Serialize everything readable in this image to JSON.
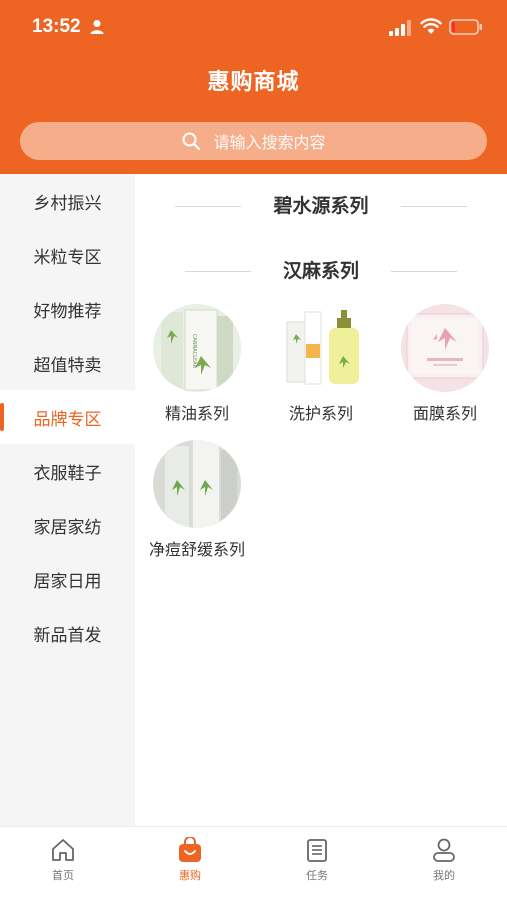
{
  "status_bar": {
    "time": "13:52"
  },
  "header": {
    "title": "惠购商城"
  },
  "search": {
    "placeholder": "请输入搜索内容"
  },
  "sidebar": {
    "items": [
      {
        "label": "乡村振兴",
        "active": false
      },
      {
        "label": "米粒专区",
        "active": false
      },
      {
        "label": "好物推荐",
        "active": false
      },
      {
        "label": "超值特卖",
        "active": false
      },
      {
        "label": "品牌专区",
        "active": true
      },
      {
        "label": "衣服鞋子",
        "active": false
      },
      {
        "label": "家居家纺",
        "active": false
      },
      {
        "label": "居家日用",
        "active": false
      },
      {
        "label": "新品首发",
        "active": false
      }
    ]
  },
  "content": {
    "sections": [
      {
        "title": "碧水源系列",
        "products": []
      },
      {
        "title": "汉麻系列",
        "products": [
          {
            "label": "精油系列"
          },
          {
            "label": "洗护系列"
          },
          {
            "label": "面膜系列"
          },
          {
            "label": "净痘舒缓系列"
          }
        ]
      }
    ]
  },
  "tabbar": {
    "items": [
      {
        "label": "首页",
        "icon": "home-icon",
        "active": false
      },
      {
        "label": "惠购",
        "icon": "shopping-bag-icon",
        "active": true
      },
      {
        "label": "任务",
        "icon": "clipboard-icon",
        "active": false
      },
      {
        "label": "我的",
        "icon": "user-icon",
        "active": false
      }
    ]
  },
  "colors": {
    "accent": "#ee6422",
    "sidebar_bg": "#f5f5f5"
  }
}
